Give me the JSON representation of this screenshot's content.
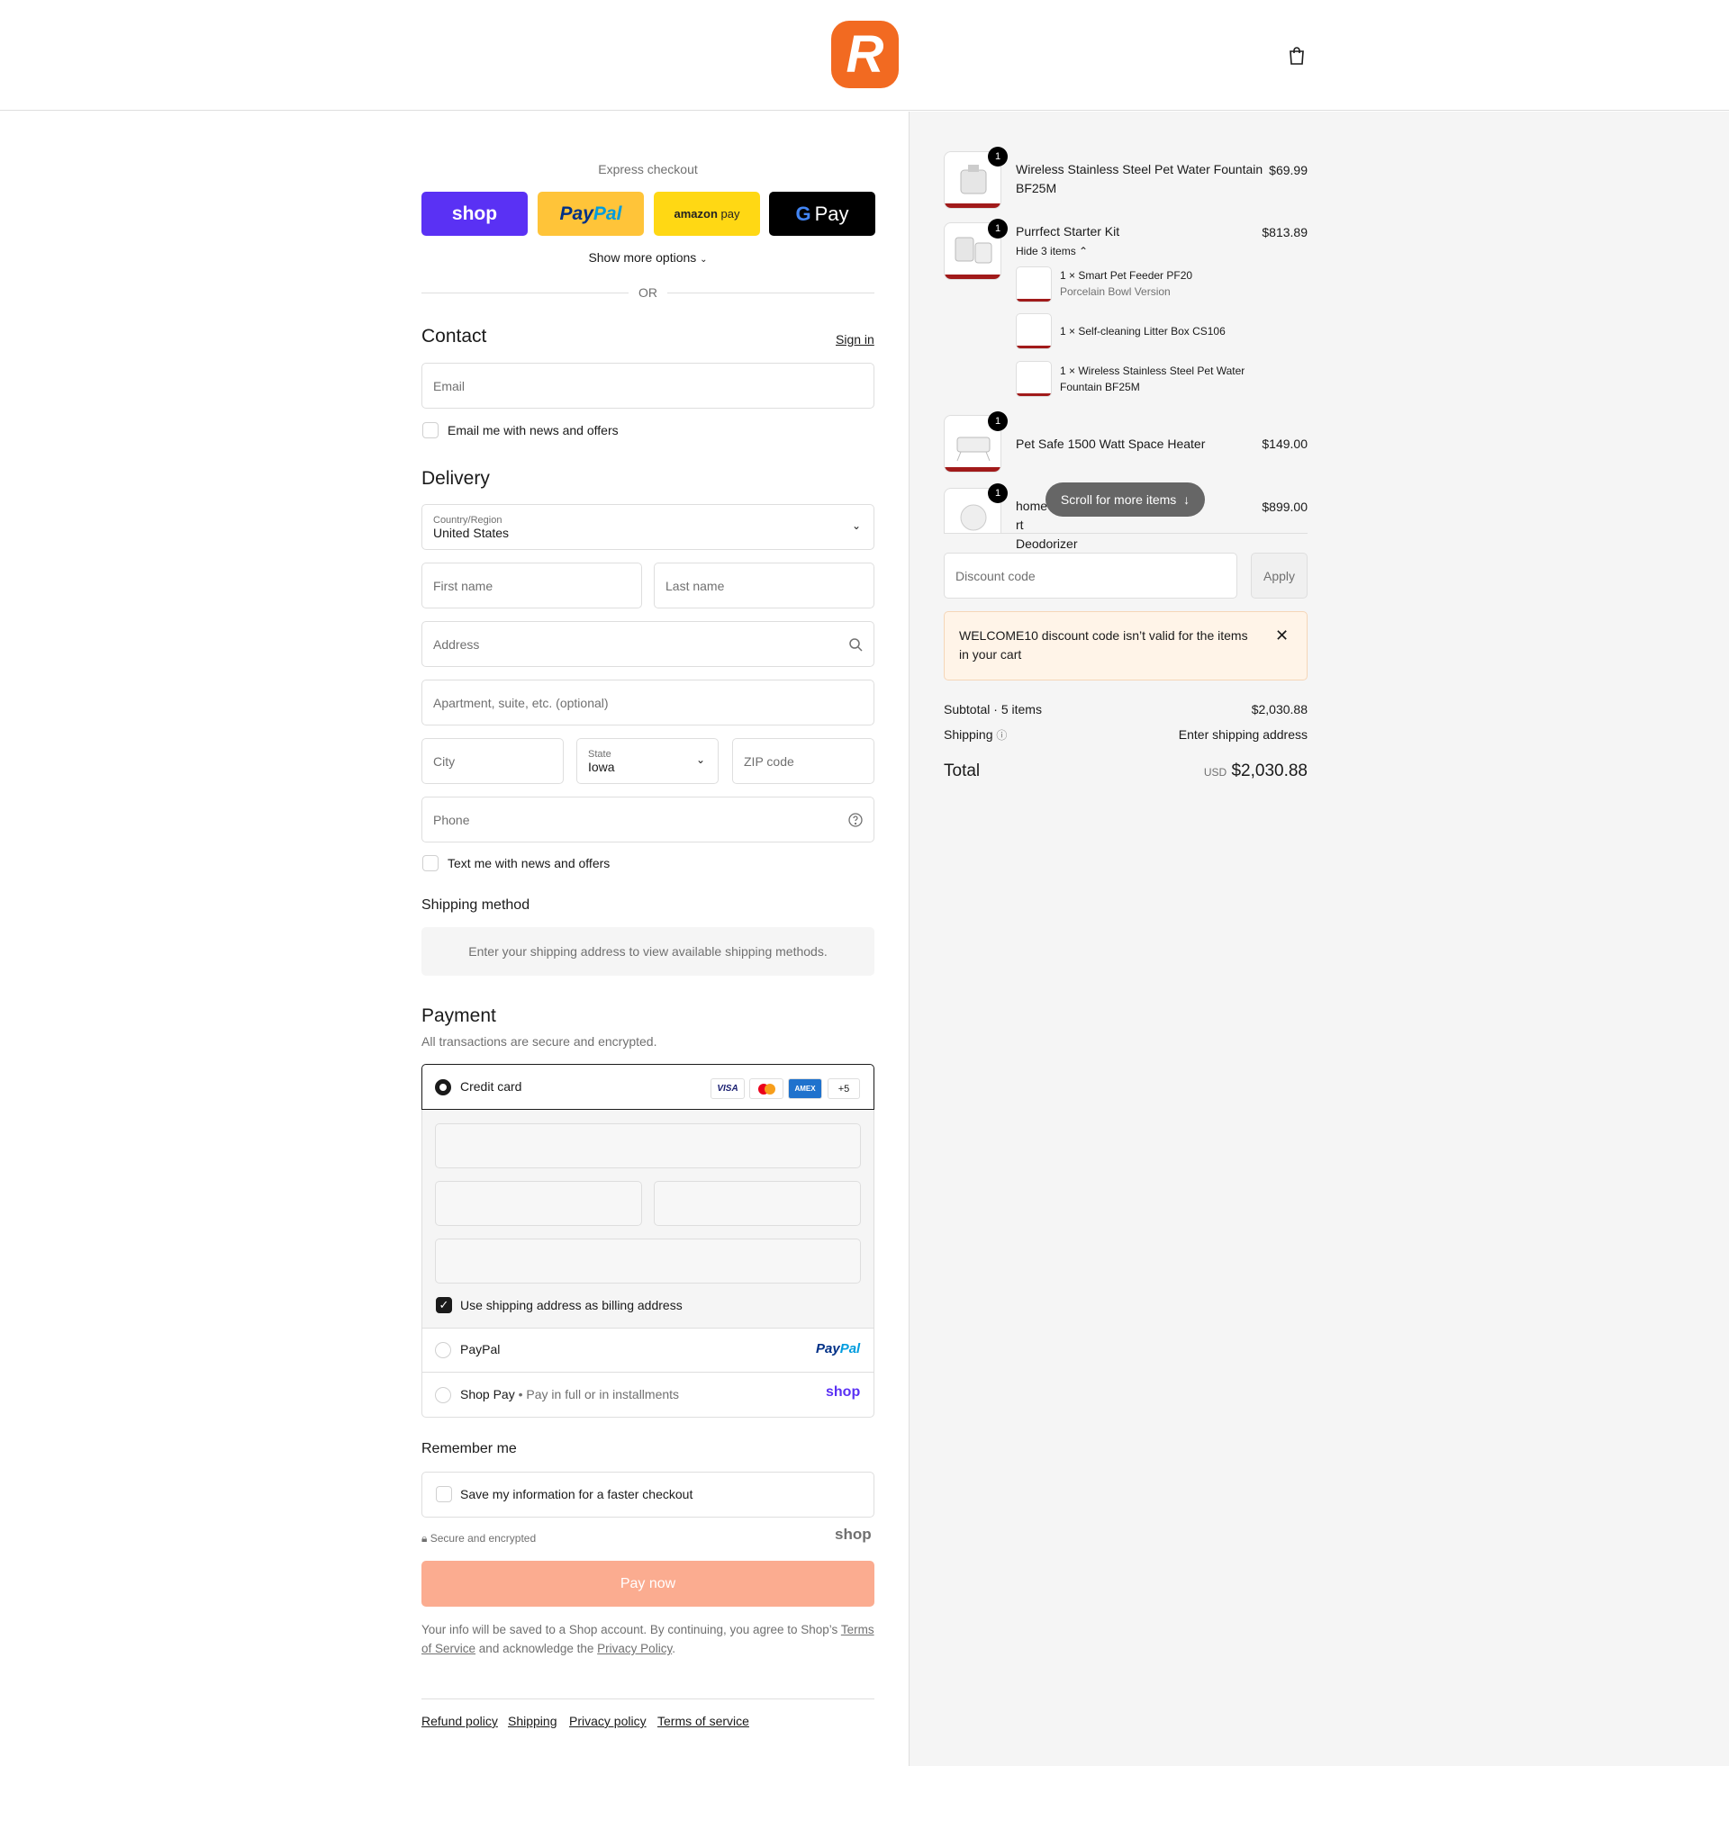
{
  "brand": {
    "logo_letter": "R",
    "accent": "#f26a21"
  },
  "express": {
    "title": "Express checkout",
    "shop": "shop",
    "paypal_a": "Pay",
    "paypal_b": "Pal",
    "amazon_a": "amazon",
    "amazon_b": "pay",
    "gpay": "Pay",
    "show_more": "Show more options",
    "or": "OR"
  },
  "contact": {
    "title": "Contact",
    "sign_in": "Sign in",
    "email_placeholder": "Email",
    "email_opt": "Email me with news and offers"
  },
  "delivery": {
    "title": "Delivery",
    "country_label": "Country/Region",
    "country_value": "United States",
    "first_name": "First name",
    "last_name": "Last name",
    "address": "Address",
    "apartment": "Apartment, suite, etc. (optional)",
    "city": "City",
    "state_label": "State",
    "state_value": "Iowa",
    "zip": "ZIP code",
    "phone": "Phone",
    "text_opt": "Text me with news and offers"
  },
  "shipping": {
    "title": "Shipping method",
    "message": "Enter your shipping address to view available shipping methods."
  },
  "payment": {
    "title": "Payment",
    "subtitle": "All transactions are secure and encrypted.",
    "credit_card": "Credit card",
    "visa": "VISA",
    "amex": "AMEX",
    "more_cards": "+5",
    "billing_same": "Use shipping address as billing address",
    "paypal": "PayPal",
    "paypal_logo_a": "Pay",
    "paypal_logo_b": "Pal",
    "shop_pay": "Shop Pay",
    "shop_pay_sub": "Pay in full or in installments",
    "shop_logo": "shop"
  },
  "remember": {
    "title": "Remember me",
    "save_info": "Save my information for a faster checkout",
    "secure": "Secure and encrypted",
    "shop_logo": "shop"
  },
  "pay_button": "Pay now",
  "legal": {
    "text_1": "Your info will be saved to a Shop account. By continuing, you agree to Shop’s",
    "terms": "Terms of Service",
    "text_2": "and acknowledge the",
    "privacy": "Privacy Policy",
    "text_3": "."
  },
  "footer": {
    "refund": "Refund policy",
    "shipping": "Shipping",
    "privacy": "Privacy policy",
    "terms": "Terms of service"
  },
  "order": {
    "items": [
      {
        "qty": "1",
        "title_1": "Wireless Stainless Steel Pet Water Fountain",
        "title_2": "BF25M",
        "price": "$69.99"
      },
      {
        "qty": "1",
        "title_1": "Purrfect Starter Kit",
        "price": "$813.89",
        "toggle": "Hide 3 items",
        "sub_items": [
          {
            "line_1": "1 × Smart Pet Feeder PF20",
            "line_2": "Porcelain Bowl Version"
          },
          {
            "line_1": "1 × Self-cleaning Litter Box CS106"
          },
          {
            "line_1": "1 × Wireless Stainless Steel Pet Water",
            "line_2": "Fountain BF25M"
          }
        ]
      },
      {
        "qty": "1",
        "title_1": "Pet Safe 1500 Watt Space Heater",
        "price": "$149.00"
      },
      {
        "qty": "1",
        "title_a": "home",
        "title_b": "rt",
        "title_2": "Deodorizer",
        "price": "$899.00"
      }
    ],
    "scroll_hint": "Scroll for more items",
    "discount_placeholder": "Discount code",
    "apply": "Apply",
    "alert": "WELCOME10 discount code isn’t valid for the items in your cart",
    "subtotal_label": "Subtotal · 5 items",
    "subtotal_value": "$2,030.88",
    "shipping_label": "Shipping",
    "shipping_value": "Enter shipping address",
    "total_label": "Total",
    "currency": "USD",
    "total_value": "$2,030.88"
  }
}
